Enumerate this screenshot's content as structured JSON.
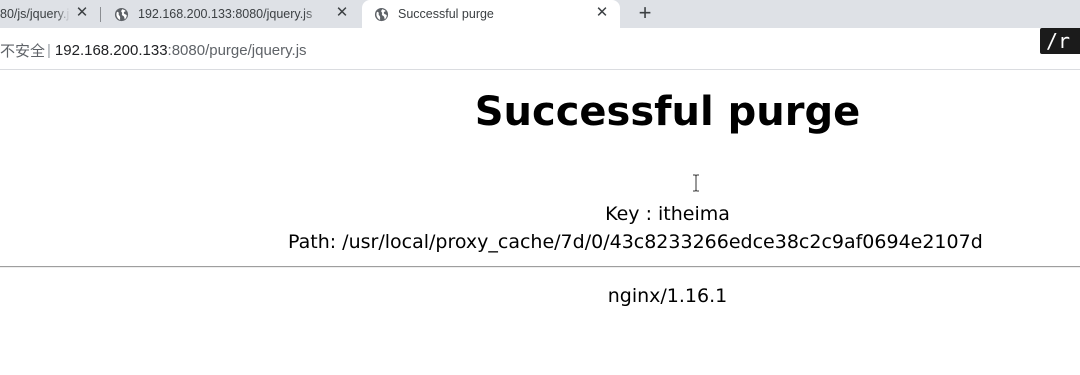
{
  "tabs": [
    {
      "title": "80/js/jquery.js",
      "active": false
    },
    {
      "title": "192.168.200.133:8080/jquery.js",
      "active": false
    },
    {
      "title": "Successful purge",
      "active": true
    }
  ],
  "new_tab_label": "+",
  "close_glyph": "✕",
  "address_bar": {
    "security_label": "不安全",
    "host": "192.168.200.133",
    "rest": ":8080/purge/jquery.js"
  },
  "overlay_badge": "/r",
  "page": {
    "heading": "Successful purge",
    "key_line": "Key : itheima",
    "path_line": "Path: /usr/local/proxy_cache/7d/0/43c8233266edce38c2c9af0694e2107d",
    "server_line": "nginx/1.16.1"
  },
  "icons": {
    "tab_favicon": "globe-icon",
    "new_tab": "plus-icon",
    "tab_close": "close-icon",
    "cursor": "text-cursor-icon"
  },
  "colors": {
    "tabstrip_bg": "#dee1e6",
    "active_tab_bg": "#ffffff",
    "url_host": "#202124",
    "url_rest": "#5f6368"
  }
}
